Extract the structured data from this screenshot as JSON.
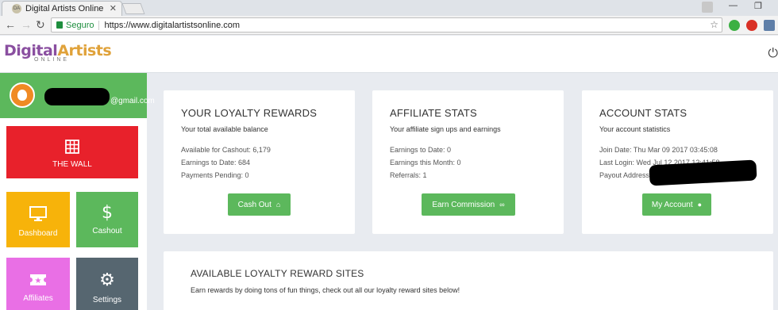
{
  "browser": {
    "tab_title": "Digital Artists Online",
    "secure_label": "Seguro",
    "url": "https://www.digitalartistsonline.com"
  },
  "site": {
    "logo_main_a": "Digital",
    "logo_main_b": "Artists",
    "logo_sub": "ONLINE"
  },
  "sidebar": {
    "email_suffix": "@gmail.com",
    "tiles": [
      {
        "label": "THE WALL",
        "icon": "grid-icon",
        "color": "#e8212b"
      },
      {
        "label": "Dashboard",
        "icon": "monitor-icon",
        "color": "#f7b30a"
      },
      {
        "label": "Cashout",
        "icon": "dollar-icon",
        "color": "#5cb85c"
      },
      {
        "label": "Affiliates",
        "icon": "ticket-icon",
        "color": "#e96fe5"
      },
      {
        "label": "Settings",
        "icon": "gear-icon",
        "color": "#566670"
      }
    ]
  },
  "cards": {
    "loyalty": {
      "title": "YOUR LOYALTY REWARDS",
      "subtitle": "Your total available balance",
      "stats": [
        "Available for Cashout: 6,179",
        "Earnings to Date: 684",
        "Payments Pending: 0"
      ],
      "button": "Cash Out"
    },
    "affiliate": {
      "title": "AFFILIATE STATS",
      "subtitle": "Your affiliate sign ups and earnings",
      "stats": [
        "Earnings to Date: 0",
        "Earnings this Month: 0",
        "Referrals: 1"
      ],
      "button": "Earn Commission"
    },
    "account": {
      "title": "ACCOUNT STATS",
      "subtitle": "Your account statistics",
      "stats": [
        "Join Date: Thu Mar 09 2017 03:45:08",
        "Last Login: Wed Jul 12 2017 12:41:58",
        "Payout Address:"
      ],
      "button": "My Account"
    },
    "sites": {
      "title": "AVAILABLE LOYALTY REWARD SITES",
      "subtitle": "Earn rewards by doing tons of fun things, check out all our loyalty reward sites below!"
    }
  },
  "colors": {
    "accent_green": "#5cb85c",
    "background": "#e8ebf0"
  }
}
